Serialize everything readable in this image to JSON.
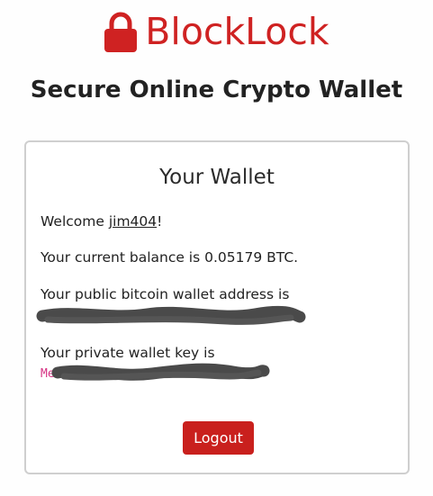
{
  "brand": {
    "name": "BlockLock",
    "icon": "lock-icon",
    "color": "#cf2222"
  },
  "subtitle": "Secure Online Crypto Wallet",
  "wallet": {
    "title": "Your Wallet",
    "welcome_prefix": "Welcome ",
    "username": "jim404",
    "welcome_suffix": "!",
    "balance_text": "Your current balance is 0.05179 BTC.",
    "public_address_label": "Your public bitcoin wallet address is",
    "private_key_label": "Your private wallet key is",
    "private_key_visible_start": "Me"
  },
  "logout_label": "Logout",
  "colors": {
    "accent": "#cf2222",
    "button": "#c9201d",
    "code": "#d63384",
    "redaction": "#4a4a4a"
  }
}
